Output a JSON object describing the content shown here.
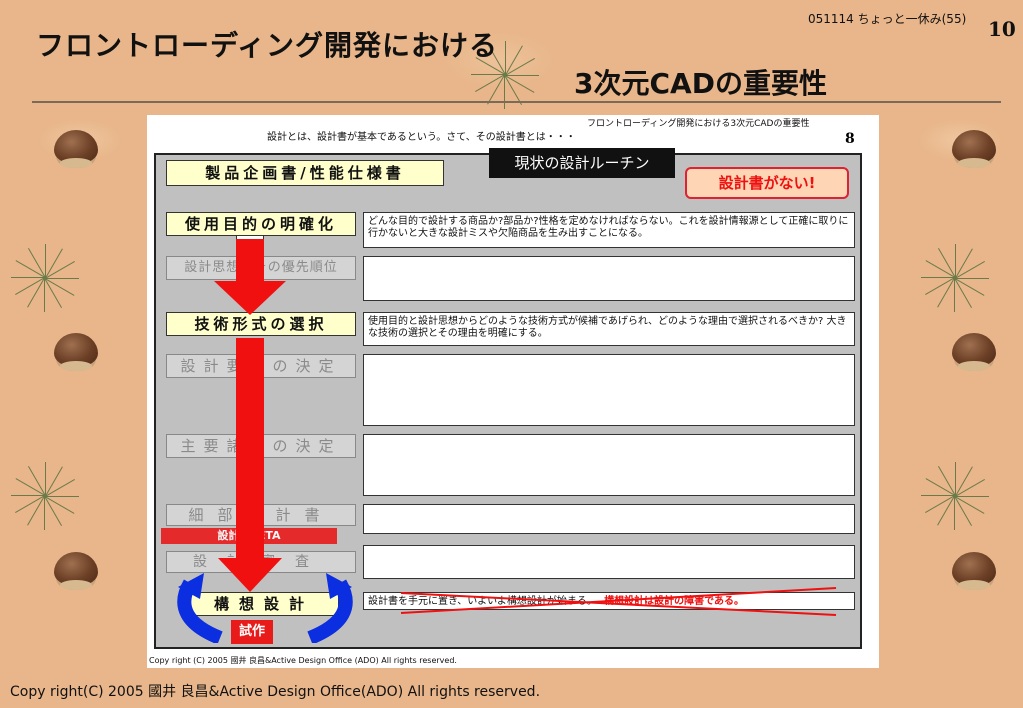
{
  "header": {
    "title": "フロントローディング開発における",
    "subtitle": "3次元CADの重要性",
    "corner_note": "051114 ちょっと一休み(55)",
    "page_number": "10"
  },
  "footer": {
    "copyright": "Copy right(C)  2005    國井 良昌&Active Design Office(ADO)  All rights reserved."
  },
  "slide": {
    "header_text": "フロントローディング開発における3次元CADの重要性",
    "intro": "設計とは、設計書が基本であるという。さて、その設計書とは・・・",
    "page_number": "8",
    "top_label": "製品企画書/性能仕様書",
    "routine_label": "現状の設計ルーチン",
    "no_design_doc": "設計書がない!",
    "rows": [
      {
        "label": "使用目的の明確化",
        "desc": "どんな目的で設計する商品か?部品か?性格を定めなければならない。これを設計情報源として正確に取りに行かないと大きな設計ミスや欠陥商品を生み出すことになる。"
      },
      {
        "label": "設計思想とその優先順位",
        "desc": ""
      },
      {
        "label": "技術形式の選択",
        "desc": "使用目的と設計思想からどのような技術方式が候補であげられ、どのような理由で選択されるべきか? 大きな技術の選択とその理由を明確にする。"
      },
      {
        "label": "設計要件の決定",
        "desc": ""
      },
      {
        "label": "主要諸元の決定",
        "desc": ""
      },
      {
        "label": "細部設計書",
        "desc": ""
      },
      {
        "label": "設計審査",
        "desc": ""
      },
      {
        "label": "構想設計",
        "desc": "設計書を手元に置き、いよいよ構想設計が始まる。"
      }
    ],
    "struck_note": "構想設計は設計の障害である。",
    "dr_tag": "設計MEETA",
    "trial_tag": "試作",
    "copyright": "Copy right (C) 2005 國井 良昌&Active Design Office (ADO)  All rights reserved."
  }
}
